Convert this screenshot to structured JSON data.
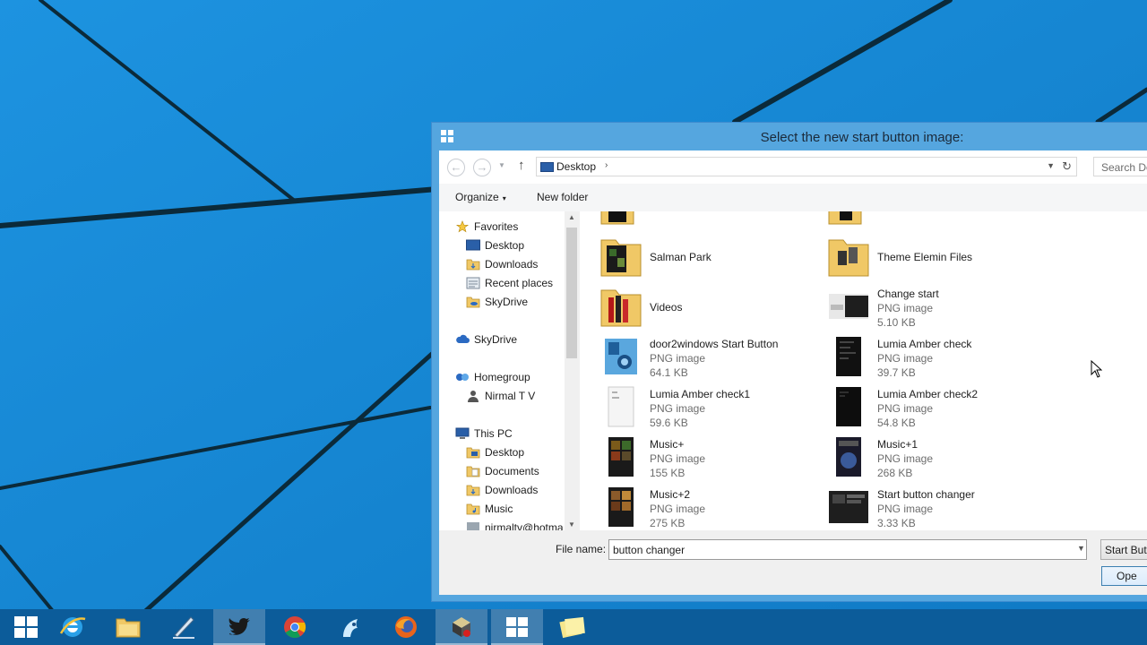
{
  "dialog": {
    "title": "Select the new start button image:",
    "title_icon": "windows-logo-icon"
  },
  "address": {
    "back_icon": "back-arrow-icon",
    "forward_icon": "forward-arrow-icon",
    "recent_icon": "chevron-down-icon",
    "up_icon": "up-arrow-icon",
    "location": "Desktop",
    "location_icon": "desktop-icon",
    "separator": "›",
    "dropdown_icon": "chevron-down-icon",
    "refresh_icon": "refresh-icon",
    "search_placeholder": "Search De"
  },
  "toolbar": {
    "organize_label": "Organize",
    "organize_arrow": "▾",
    "new_folder_label": "New folder"
  },
  "nav": {
    "favorites": {
      "label": "Favorites",
      "icon": "star-icon"
    },
    "fav_items": [
      {
        "label": "Desktop",
        "icon": "desktop-icon"
      },
      {
        "label": "Downloads",
        "icon": "downloads-folder-icon"
      },
      {
        "label": "Recent places",
        "icon": "recent-places-icon"
      },
      {
        "label": "SkyDrive",
        "icon": "skydrive-folder-icon"
      }
    ],
    "skydrive": {
      "label": "SkyDrive",
      "icon": "cloud-icon"
    },
    "homegroup": {
      "label": "Homegroup",
      "icon": "homegroup-icon"
    },
    "homegroup_user": {
      "label": "Nirmal T V",
      "icon": "user-icon"
    },
    "thispc": {
      "label": "This PC",
      "icon": "computer-icon"
    },
    "pc_items": [
      {
        "label": "Desktop",
        "icon": "desktop-folder-icon"
      },
      {
        "label": "Documents",
        "icon": "documents-folder-icon"
      },
      {
        "label": "Downloads",
        "icon": "downloads-folder-icon"
      },
      {
        "label": "Music",
        "icon": "music-folder-icon"
      },
      {
        "label": "nirmaltv@hotma",
        "icon": "user-folder-icon"
      }
    ]
  },
  "files": [
    {
      "name": "Salman Park",
      "type": "",
      "size": "",
      "icon": "folder-icon"
    },
    {
      "name": "Theme Elemin Files",
      "type": "",
      "size": "",
      "icon": "folder-icon"
    },
    {
      "name": "Videos",
      "type": "",
      "size": "",
      "icon": "folder-icon"
    },
    {
      "name": "Change start",
      "type": "PNG image",
      "size": "5.10 KB",
      "icon": "image-thumbnail-icon"
    },
    {
      "name": "door2windows Start Button",
      "type": "PNG image",
      "size": "64.1 KB",
      "icon": "image-thumbnail-icon"
    },
    {
      "name": "Lumia Amber check",
      "type": "PNG image",
      "size": "39.7 KB",
      "icon": "image-thumbnail-icon"
    },
    {
      "name": "Lumia Amber check1",
      "type": "PNG image",
      "size": "59.6 KB",
      "icon": "image-thumbnail-icon"
    },
    {
      "name": "Lumia Amber check2",
      "type": "PNG image",
      "size": "54.8 KB",
      "icon": "image-thumbnail-icon"
    },
    {
      "name": "Music+",
      "type": "PNG image",
      "size": "155 KB",
      "icon": "image-thumbnail-icon"
    },
    {
      "name": "Music+1",
      "type": "PNG image",
      "size": "268 KB",
      "icon": "image-thumbnail-icon"
    },
    {
      "name": "Music+2",
      "type": "PNG image",
      "size": "275 KB",
      "icon": "image-thumbnail-icon"
    },
    {
      "name": "Start button changer",
      "type": "PNG image",
      "size": "3.33 KB",
      "icon": "image-thumbnail-icon"
    }
  ],
  "footer": {
    "file_name_label": "File name:",
    "file_name_value": "button changer",
    "filter_label": "Start Butt",
    "open_label": "Ope"
  },
  "taskbar": {
    "items": [
      {
        "icon": "start-windows-icon",
        "active": false
      },
      {
        "icon": "internet-explorer-icon",
        "active": false
      },
      {
        "icon": "file-explorer-icon",
        "active": false
      },
      {
        "icon": "writing-pen-icon",
        "active": false
      },
      {
        "icon": "twitter-icon",
        "active": true
      },
      {
        "icon": "chrome-icon",
        "active": false
      },
      {
        "icon": "bird-app-icon",
        "active": false
      },
      {
        "icon": "firefox-icon",
        "active": false
      },
      {
        "icon": "app-installer-icon",
        "active": true
      },
      {
        "icon": "windows-logo-icon",
        "active": true
      },
      {
        "icon": "sticky-notes-icon",
        "active": false
      }
    ]
  },
  "colors": {
    "wallpaper": "#1688d8",
    "dialog_frame": "#55a6df",
    "taskbar": "#0c5c9a"
  }
}
